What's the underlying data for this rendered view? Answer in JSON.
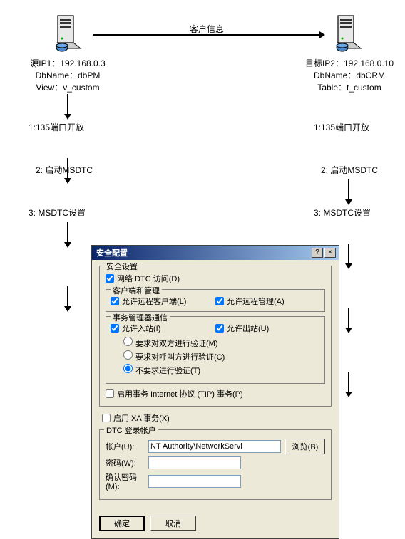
{
  "diagram": {
    "source": {
      "ip_label": "源IP1：192.168.0.3",
      "db_label": "DbName：dbPM",
      "view_label": "View：v_custom"
    },
    "target": {
      "ip_label": "目标IP2：192.168.0.10",
      "db_label": "DbName：dbCRM",
      "table_label": "Table：t_custom"
    },
    "link_label": "客户信息",
    "steps": {
      "s1": "1:135端口开放",
      "s2": "2: 启动MSDTC",
      "s3": "3: MSDTC设置"
    }
  },
  "dialog": {
    "title": "安全配置",
    "security_settings": "安全设置",
    "network_dtc": "网络 DTC 访问(D)",
    "client_admin": "客户端和管理",
    "allow_remote_client": "允许远程客户端(L)",
    "allow_remote_admin": "允许远程管理(A)",
    "tm_comm": "事务管理器通信",
    "allow_inbound": "允许入站(I)",
    "allow_outbound": "允许出站(U)",
    "mutual_auth": "要求对双方进行验证(M)",
    "caller_auth": "要求对呼叫方进行验证(C)",
    "no_auth": "不要求进行验证(T)",
    "enable_tip": "启用事务 Internet 协议 (TIP) 事务(P)",
    "enable_xa": "启用 XA 事务(X)",
    "dtc_account": "DTC 登录帐户",
    "account_label": "帐户(U):",
    "account_value": "NT Authority\\NetworkServi",
    "browse": "浏览(B)",
    "password_label": "密码(W):",
    "confirm_label": "确认密码(M):",
    "ok": "确定",
    "cancel": "取消",
    "help_btn": "?",
    "close_btn": "×"
  }
}
